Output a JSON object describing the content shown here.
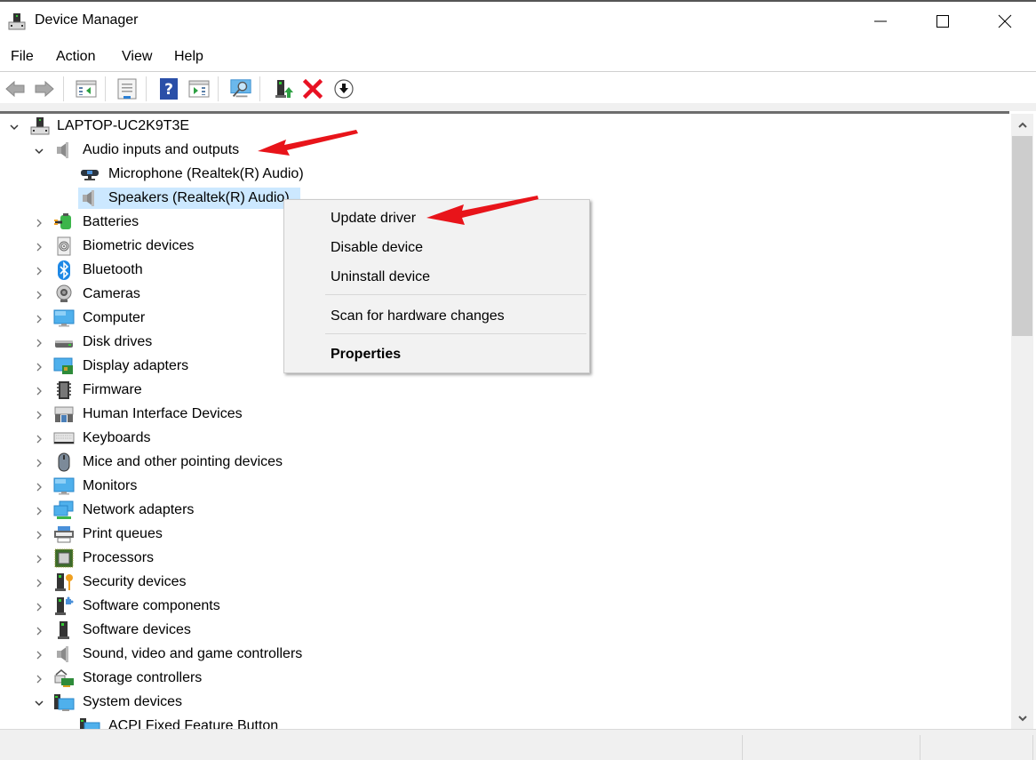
{
  "window": {
    "title": "Device Manager",
    "controls": {
      "minimize": "minimize",
      "maximize": "maximize",
      "close": "close"
    }
  },
  "menubar": {
    "items": [
      "File",
      "Action",
      "View",
      "Help"
    ]
  },
  "toolbar": {
    "buttons": [
      {
        "name": "back",
        "icon": "back-arrow-icon",
        "enabled": false
      },
      {
        "name": "forward",
        "icon": "forward-arrow-icon",
        "enabled": false
      },
      {
        "name": "show-hide-console-tree",
        "icon": "console-tree-icon"
      },
      {
        "name": "properties",
        "icon": "properties-icon"
      },
      {
        "name": "help",
        "icon": "help-icon"
      },
      {
        "name": "show-hide-action-pane",
        "icon": "action-pane-icon"
      },
      {
        "name": "scan-for-hardware-changes",
        "icon": "scan-monitor-icon"
      },
      {
        "name": "update-driver",
        "icon": "update-driver-icon"
      },
      {
        "name": "uninstall-device",
        "icon": "red-x-icon"
      },
      {
        "name": "disable-device",
        "icon": "down-arrow-circle-icon"
      }
    ]
  },
  "tree": {
    "root": {
      "label": "LAPTOP-UC2K9T3E",
      "expanded": true,
      "icon": "computer-tower-icon"
    },
    "items": [
      {
        "label": "Audio inputs and outputs",
        "level": 1,
        "expanded": true,
        "icon": "speaker-icon"
      },
      {
        "label": "Microphone (Realtek(R) Audio)",
        "level": 2,
        "icon": "microphone-icon"
      },
      {
        "label": "Speakers (Realtek(R) Audio)",
        "level": 2,
        "icon": "speaker-icon",
        "selected": true
      },
      {
        "label": "Batteries",
        "level": 1,
        "expanded": false,
        "icon": "battery-icon"
      },
      {
        "label": "Biometric devices",
        "level": 1,
        "expanded": false,
        "icon": "fingerprint-icon"
      },
      {
        "label": "Bluetooth",
        "level": 1,
        "expanded": false,
        "icon": "bluetooth-icon"
      },
      {
        "label": "Cameras",
        "level": 1,
        "expanded": false,
        "icon": "webcam-icon"
      },
      {
        "label": "Computer",
        "level": 1,
        "expanded": false,
        "icon": "monitor-icon"
      },
      {
        "label": "Disk drives",
        "level": 1,
        "expanded": false,
        "icon": "disk-drive-icon"
      },
      {
        "label": "Display adapters",
        "level": 1,
        "expanded": false,
        "icon": "display-adapter-icon"
      },
      {
        "label": "Firmware",
        "level": 1,
        "expanded": false,
        "icon": "chip-icon"
      },
      {
        "label": "Human Interface Devices",
        "level": 1,
        "expanded": false,
        "icon": "hid-icon"
      },
      {
        "label": "Keyboards",
        "level": 1,
        "expanded": false,
        "icon": "keyboard-icon"
      },
      {
        "label": "Mice and other pointing devices",
        "level": 1,
        "expanded": false,
        "icon": "mouse-icon"
      },
      {
        "label": "Monitors",
        "level": 1,
        "expanded": false,
        "icon": "monitor-icon"
      },
      {
        "label": "Network adapters",
        "level": 1,
        "expanded": false,
        "icon": "network-icon"
      },
      {
        "label": "Print queues",
        "level": 1,
        "expanded": false,
        "icon": "printer-icon"
      },
      {
        "label": "Processors",
        "level": 1,
        "expanded": false,
        "icon": "processor-icon"
      },
      {
        "label": "Security devices",
        "level": 1,
        "expanded": false,
        "icon": "security-key-icon"
      },
      {
        "label": "Software components",
        "level": 1,
        "expanded": false,
        "icon": "software-component-icon"
      },
      {
        "label": "Software devices",
        "level": 1,
        "expanded": false,
        "icon": "software-device-icon"
      },
      {
        "label": "Sound, video and game controllers",
        "level": 1,
        "expanded": false,
        "icon": "speaker-icon"
      },
      {
        "label": "Storage controllers",
        "level": 1,
        "expanded": false,
        "icon": "storage-controller-icon"
      },
      {
        "label": "System devices",
        "level": 1,
        "expanded": true,
        "icon": "system-folder-icon"
      },
      {
        "label": "ACPI Fixed Feature Button",
        "level": 2,
        "icon": "system-folder-icon"
      }
    ]
  },
  "context_menu": {
    "items": [
      {
        "label": "Update driver",
        "bold": false
      },
      {
        "label": "Disable device",
        "bold": false
      },
      {
        "label": "Uninstall device",
        "bold": false
      },
      {
        "separator": true
      },
      {
        "label": "Scan for hardware changes",
        "bold": false
      },
      {
        "separator": true
      },
      {
        "label": "Properties",
        "bold": true
      }
    ]
  },
  "scrollbar": {
    "position_fraction": 0.0,
    "visible_fraction": 0.35
  },
  "colors": {
    "selection": "#cce8ff",
    "context_menu_bg": "#f2f2f2",
    "annotation_arrow": "#e8141a",
    "status_bar": "#f0f0f0"
  }
}
